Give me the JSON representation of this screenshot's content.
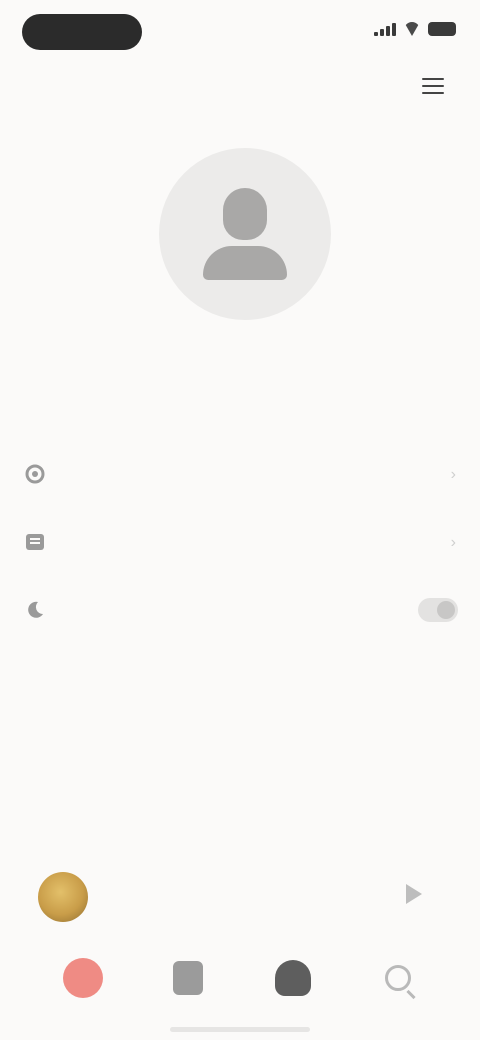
{
  "status_bar": {
    "time": "",
    "icons": [
      "signal-icon",
      "wifi-icon",
      "battery-icon"
    ]
  },
  "header": {
    "title": "",
    "menu_icon": "menu-icon"
  },
  "profile": {
    "name": "",
    "subtitle": ""
  },
  "settings": {
    "items": [
      {
        "icon": "settings-icon",
        "label": ""
      },
      {
        "icon": "library-icon",
        "label": ""
      },
      {
        "icon": "moon-icon",
        "label": ""
      }
    ]
  },
  "player": {
    "title": "",
    "artist": "",
    "control": "play-icon"
  },
  "nav": {
    "items": [
      "home-icon",
      "library-icon",
      "profile-icon",
      "search-icon"
    ]
  },
  "colors": {
    "background": "#fbfaf9",
    "accent": "#ef8b84",
    "album": "#c99d49"
  }
}
